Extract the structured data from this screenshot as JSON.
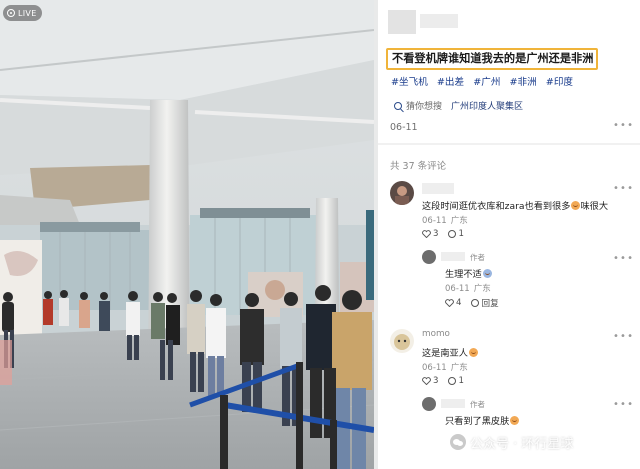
{
  "photo": {
    "live_label": "LIVE"
  },
  "post": {
    "title": "不看登机牌谁知道我去的是广州还是非洲",
    "title_highlight_color": "#f0b43a",
    "tags": [
      "#坐飞机",
      "#出差",
      "#广州",
      "#非洲",
      "#印度"
    ],
    "guess_label": "猜你想搜",
    "guess_query": "广州印度人聚集区",
    "date": "06-11",
    "more_icon": "more-dots-icon"
  },
  "comments": {
    "count_label": "共 37 条评论",
    "items": [
      {
        "text": "这段时间逛优衣库和zara也看到很多",
        "text_tail": "味很大",
        "date": "06-11",
        "location": "广东",
        "likes": "3",
        "replies": "1"
      },
      {
        "is_reply": true,
        "author_tag": "作者",
        "text": "生理不适",
        "date": "06-11",
        "location": "广东",
        "likes": "4",
        "reply_label": "回复"
      },
      {
        "username": "momo",
        "text": "这是南亚人",
        "date": "06-11",
        "location": "广东",
        "likes": "3",
        "replies": "1"
      },
      {
        "is_reply": true,
        "author_tag": "作者",
        "text": "只看到了黑皮肤"
      }
    ]
  },
  "watermark": {
    "text": "公众号 · 环行星球"
  },
  "colors": {
    "link_blue": "#1b3d8c",
    "muted": "#8c8c8c"
  }
}
